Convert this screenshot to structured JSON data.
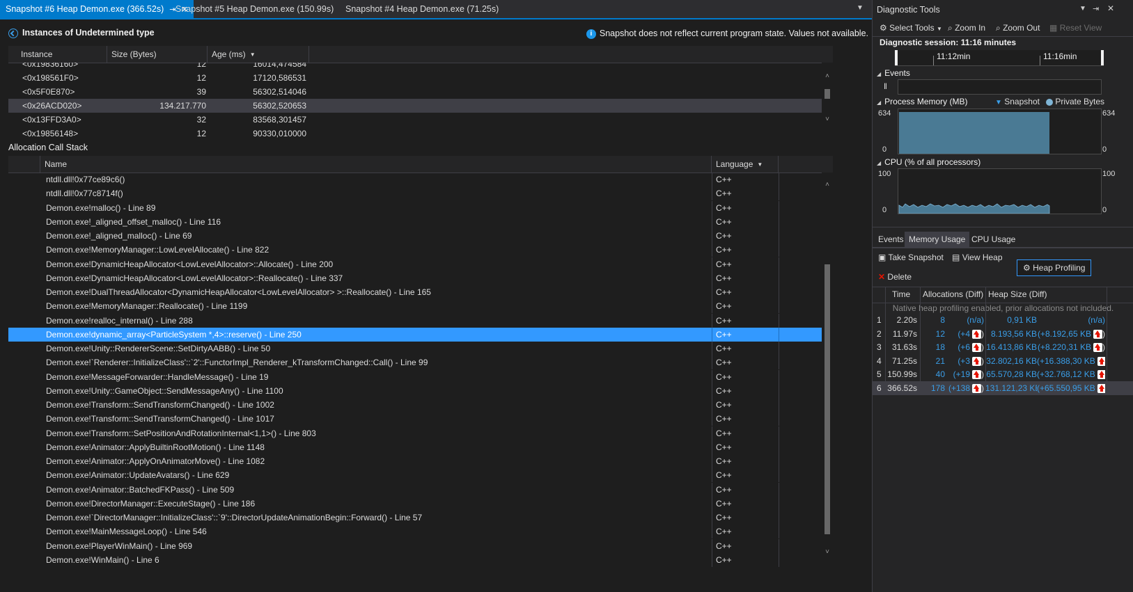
{
  "tabs": [
    {
      "label": "Snapshot #6 Heap Demon.exe (366.52s)",
      "active": true
    },
    {
      "label": "Snapshot #5 Heap Demon.exe (150.99s)",
      "active": false
    },
    {
      "label": "Snapshot #4 Heap Demon.exe (71.25s)",
      "active": false
    }
  ],
  "instances_panel": {
    "title": "Instances of Undetermined type",
    "notice": "Snapshot does not reflect current program state. Values not available.",
    "columns": [
      "Instance",
      "Size (Bytes)",
      "Age (ms)"
    ],
    "rows": [
      {
        "instance": "<0x19836160>",
        "size": "12",
        "age": "16014,474584"
      },
      {
        "instance": "<0x198561F0>",
        "size": "12",
        "age": "17120,586531"
      },
      {
        "instance": "<0x5F0E870>",
        "size": "39",
        "age": "56302,514046"
      },
      {
        "instance": "<0x26ACD020>",
        "size": "134.217.770",
        "age": "56302,520653"
      },
      {
        "instance": "<0x13FFD3A0>",
        "size": "32",
        "age": "83568,301457"
      },
      {
        "instance": "<0x19856148>",
        "size": "12",
        "age": "90330,010000"
      }
    ],
    "selected_row": 3
  },
  "call_stack": {
    "title": "Allocation Call Stack",
    "columns": [
      "Name",
      "Language"
    ],
    "rows": [
      "ntdll.dll!0x77ce89c6()",
      "ntdll.dll!0x77c8714f()",
      "Demon.exe!malloc() - Line 89",
      "Demon.exe!_aligned_offset_malloc() - Line 116",
      "Demon.exe!_aligned_malloc() - Line 69",
      "Demon.exe!MemoryManager::LowLevelAllocate() - Line 822",
      "Demon.exe!DynamicHeapAllocator<LowLevelAllocator>::Allocate() - Line 200",
      "Demon.exe!DynamicHeapAllocator<LowLevelAllocator>::Reallocate() - Line 337",
      "Demon.exe!DualThreadAllocator<DynamicHeapAllocator<LowLevelAllocator> >::Reallocate() - Line 165",
      "Demon.exe!MemoryManager::Reallocate() - Line 1199",
      "Demon.exe!realloc_internal() - Line 288",
      "Demon.exe!dynamic_array<ParticleSystem *,4>::reserve() - Line 250",
      "Demon.exe!Unity::RendererScene::SetDirtyAABB() - Line 50",
      "Demon.exe!`Renderer::InitializeClass'::`2'::FunctorImpl_Renderer_kTransformChanged::Call() - Line 99",
      "Demon.exe!MessageForwarder::HandleMessage() - Line 19",
      "Demon.exe!Unity::GameObject::SendMessageAny() - Line 1100",
      "Demon.exe!Transform::SendTransformChanged() - Line 1002",
      "Demon.exe!Transform::SendTransformChanged() - Line 1017",
      "Demon.exe!Transform::SetPositionAndRotationInternal<1,1>() - Line 803",
      "Demon.exe!Animator::ApplyBuiltinRootMotion() - Line 1148",
      "Demon.exe!Animator::ApplyOnAnimatorMove() - Line 1082",
      "Demon.exe!Animator::UpdateAvatars() - Line 629",
      "Demon.exe!Animator::BatchedFKPass() - Line 509",
      "Demon.exe!DirectorManager::ExecuteStage() - Line 186",
      "Demon.exe!`DirectorManager::InitializeClass'::`9'::DirectorUpdateAnimationBegin::Forward() - Line 57",
      "Demon.exe!MainMessageLoop() - Line 546",
      "Demon.exe!PlayerWinMain() - Line 969",
      "Demon.exe!WinMain() - Line 6"
    ],
    "language": "C++",
    "selected_row": 11
  },
  "diagnostics": {
    "title": "Diagnostic Tools",
    "toolbar": {
      "select_tools": "Select Tools",
      "zoom_in": "Zoom In",
      "zoom_out": "Zoom Out",
      "reset_view": "Reset View"
    },
    "session": "Diagnostic session: 11:16 minutes",
    "ruler": [
      "11:12min",
      "11:16min"
    ],
    "events_label": "Events",
    "memory_label": "Process Memory (MB)",
    "legend_snapshot": "Snapshot",
    "legend_private": "Private Bytes",
    "memory_max": "634",
    "memory_min": "0",
    "cpu_label": "CPU (% of all processors)",
    "cpu_max": "100",
    "cpu_min": "0",
    "tabs": [
      "Events",
      "Memory Usage",
      "CPU Usage"
    ],
    "active_tab": 1,
    "take_snapshot": "Take Snapshot",
    "view_heap": "View Heap",
    "heap_profiling": "Heap Profiling",
    "delete": "Delete",
    "columns": [
      "Time",
      "Allocations (Diff)",
      "Heap Size (Diff)"
    ],
    "notice": "Native heap profiling enabled, prior allocations not included.",
    "snapshots": [
      {
        "id": "1",
        "time": "2.20s",
        "allocs": "8",
        "alloc_diff": "(n/a)",
        "heap": "0,91 KB",
        "heap_diff": "(n/a)"
      },
      {
        "id": "2",
        "time": "11.97s",
        "allocs": "12",
        "alloc_diff": "(+4",
        "heap": "8.193,56 KB",
        "heap_diff": "(+8.192,65 KB"
      },
      {
        "id": "3",
        "time": "31.63s",
        "allocs": "18",
        "alloc_diff": "(+6",
        "heap": "16.413,86 KB",
        "heap_diff": "(+8.220,31 KB"
      },
      {
        "id": "4",
        "time": "71.25s",
        "allocs": "21",
        "alloc_diff": "(+3",
        "heap": "32.802,16 KB",
        "heap_diff": "(+16.388,30 KB"
      },
      {
        "id": "5",
        "time": "150.99s",
        "allocs": "40",
        "alloc_diff": "(+19",
        "heap": "65.570,28 KB",
        "heap_diff": "(+32.768,12 KB"
      },
      {
        "id": "6",
        "time": "366.52s",
        "allocs": "178",
        "alloc_diff": "(+138",
        "heap": "131.121,23 KB",
        "heap_diff": "(+65.550,95 KB"
      }
    ],
    "selected_snapshot": 5
  },
  "colors": {
    "accent": "#007acc",
    "selection": "#3399ff",
    "link": "#3a9ee8",
    "memory_fill": "#4a7a94"
  }
}
